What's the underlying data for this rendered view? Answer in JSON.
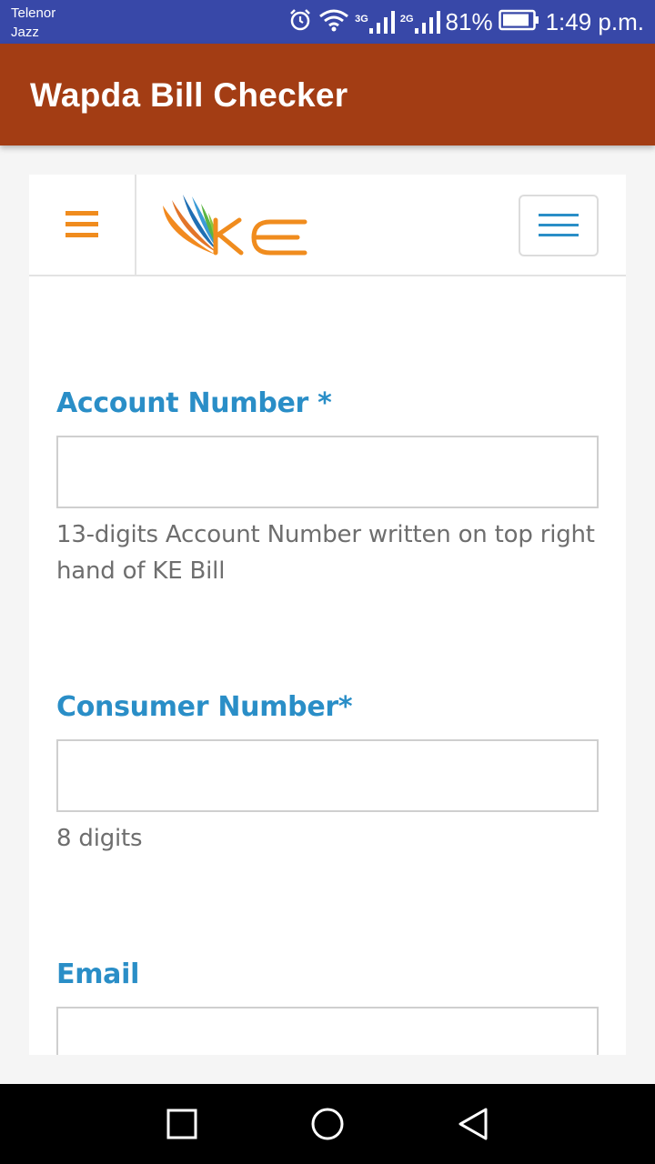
{
  "status_bar": {
    "carrier_line1": "Telenor",
    "carrier_line2": "Jazz",
    "net1": "3G",
    "net2": "2G",
    "battery": "81%",
    "time": "1:49 p.m.",
    "icons": [
      "alarm-icon",
      "wifi-icon",
      "signal-icon",
      "signal-icon",
      "battery-icon"
    ]
  },
  "app_bar": {
    "title": "Wapda Bill Checker"
  },
  "site_header": {
    "logo_text": "KE",
    "menu_icon": "menu-icon",
    "toggle_icon": "menu-icon",
    "colors": {
      "menu_orange": "#f08c1e",
      "toggle_blue": "#2a8ec7"
    }
  },
  "form": {
    "account": {
      "label": "Account Number *",
      "value": "",
      "help": "13-digits Account Number written on top right hand of KE Bill"
    },
    "consumer": {
      "label": "Consumer Number*",
      "value": "",
      "help": "8 digits"
    },
    "email": {
      "label": "Email",
      "value": ""
    }
  },
  "nav_bar": {
    "icons": [
      "recents-icon",
      "home-icon",
      "back-icon"
    ]
  },
  "colors": {
    "status_bar": "#3848a8",
    "app_bar": "#a33d14",
    "label": "#2a8ec7",
    "help_text": "#6e6e6e"
  }
}
